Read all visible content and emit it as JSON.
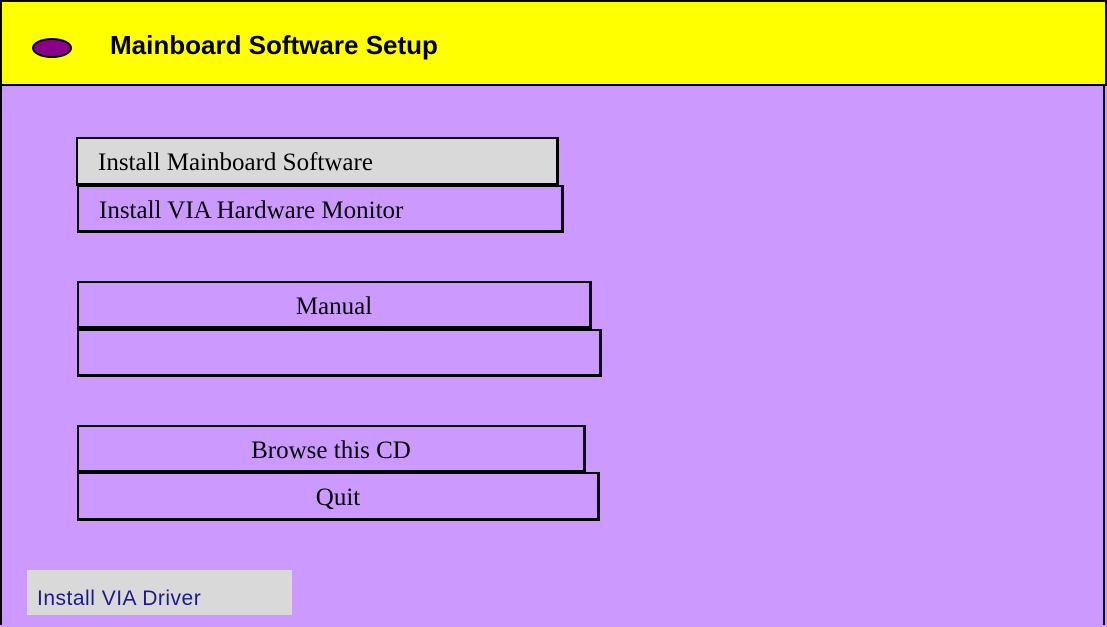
{
  "header": {
    "title": "Mainboard Software Setup",
    "icon": "purple-oval-icon"
  },
  "menu": {
    "install_mainboard_software": "Install Mainboard Software",
    "install_via_hardware_monitor": "Install VIA Hardware Monitor",
    "manual": "Manual",
    "blank": "",
    "browse_cd": "Browse this CD",
    "quit": "Quit"
  },
  "footer": {
    "install_via_driver": "Install VIA Driver"
  },
  "colors": {
    "background": "#cc99ff",
    "title_bar": "#ffff00",
    "highlight_button": "#d9d9d9",
    "icon": "#8b008b",
    "driver_text": "#1a1a8a"
  }
}
